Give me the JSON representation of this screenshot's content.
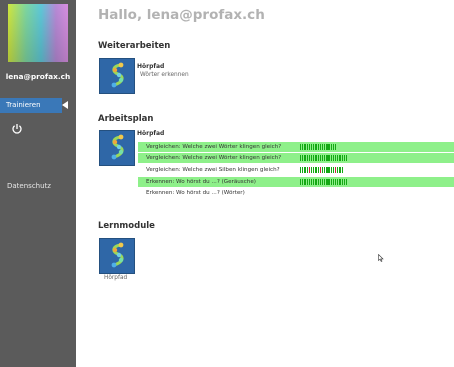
{
  "sidebar": {
    "user": "lena@profax.ch",
    "nav_train": "Trainieren",
    "privacy": "Datenschutz"
  },
  "main": {
    "greeting": "Hallo, lena@profax.ch",
    "continue": {
      "title": "Weiterarbeiten",
      "item_title": "Hörpfad",
      "item_sub": "Wörter erkennen"
    },
    "plan": {
      "title": "Arbeitsplan",
      "item_title": "Hörpfad",
      "rows": [
        {
          "text": "Vergleichen: Welche zwei Wörter klingen gleich?",
          "highlight": true,
          "meter": [
            "g",
            "g",
            "g",
            "g",
            "g",
            "g",
            "g",
            "g",
            "g",
            "g",
            "g",
            "g",
            "g",
            "g",
            "g",
            "g",
            "g"
          ]
        },
        {
          "text": "Vergleichen: Welche zwei Wörter klingen gleich?",
          "highlight": true,
          "meter": [
            "g",
            "g",
            "g",
            "g",
            "g",
            "g",
            "g",
            "g",
            "g",
            "g",
            "g",
            "g",
            "g",
            "g",
            "g",
            "g",
            "g",
            "g",
            "g",
            "g",
            "g",
            "g"
          ]
        },
        {
          "text": "Vergleichen: Welche zwei Silben klingen gleich?",
          "highlight": false,
          "meter": [
            "g",
            "g",
            "g",
            "g",
            "r",
            "g",
            "g",
            "g",
            "g",
            "r",
            "g",
            "g",
            "g",
            "g",
            "g",
            "g",
            "r",
            "g",
            "g",
            "g"
          ]
        },
        {
          "text": "Erkennen: Wo hörst du ...? (Geräusche)",
          "highlight": true,
          "meter": [
            "g",
            "g",
            "g",
            "g",
            "g",
            "g",
            "g",
            "g",
            "g",
            "g",
            "g",
            "g",
            "g",
            "g",
            "g",
            "g",
            "g",
            "g",
            "g",
            "g",
            "g",
            "g"
          ]
        },
        {
          "text": "Erkennen: Wo hörst du ...? (Wörter)",
          "highlight": false,
          "meter": []
        }
      ]
    },
    "modules": {
      "title": "Lernmodule",
      "item_label": "Hörpfad"
    }
  },
  "colors": {
    "sidebar": "#5b5b5b",
    "nav_active": "#3a78b8",
    "row_highlight": "#8ef08a",
    "meter_green": "#14a814",
    "meter_red": "#c8283c",
    "icon_blue": "#2f67a7"
  }
}
